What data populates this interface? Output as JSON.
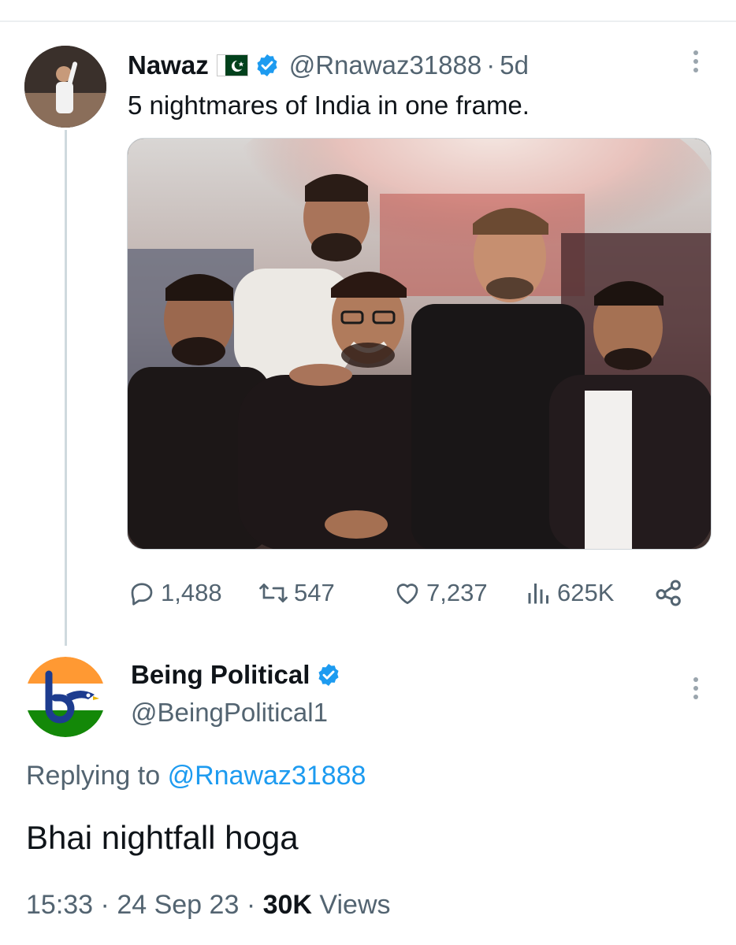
{
  "colors": {
    "accent": "#1d9bf0",
    "text_primary": "#0f1419",
    "text_secondary": "#536471",
    "thread_line": "#cfd9de"
  },
  "parent_tweet": {
    "display_name": "Nawaz",
    "flag_icon": "pakistan-flag-icon",
    "verified_icon": "verified-badge-icon",
    "handle": "@Rnawaz31888",
    "separator": "·",
    "time_ago": "5d",
    "text": "5 nightmares of India in one frame.",
    "media_icon": "group-photo-five-men",
    "stats": {
      "replies": "1,488",
      "retweets": "547",
      "likes": "7,237",
      "views": "625K"
    },
    "action_icons": [
      "reply-icon",
      "retweet-icon",
      "like-icon",
      "views-icon",
      "share-icon"
    ]
  },
  "reply_tweet": {
    "display_name": "Being Political",
    "verified_icon": "verified-badge-icon",
    "handle": "@BeingPolitical1",
    "replying_prefix": "Replying to",
    "replying_to": "@Rnawaz31888",
    "text": "Bhai nightfall hoga",
    "time": "15:33",
    "separator1": "·",
    "date": "24 Sep 23",
    "separator2": "·",
    "views_count": "30K",
    "views_label": "Views"
  }
}
